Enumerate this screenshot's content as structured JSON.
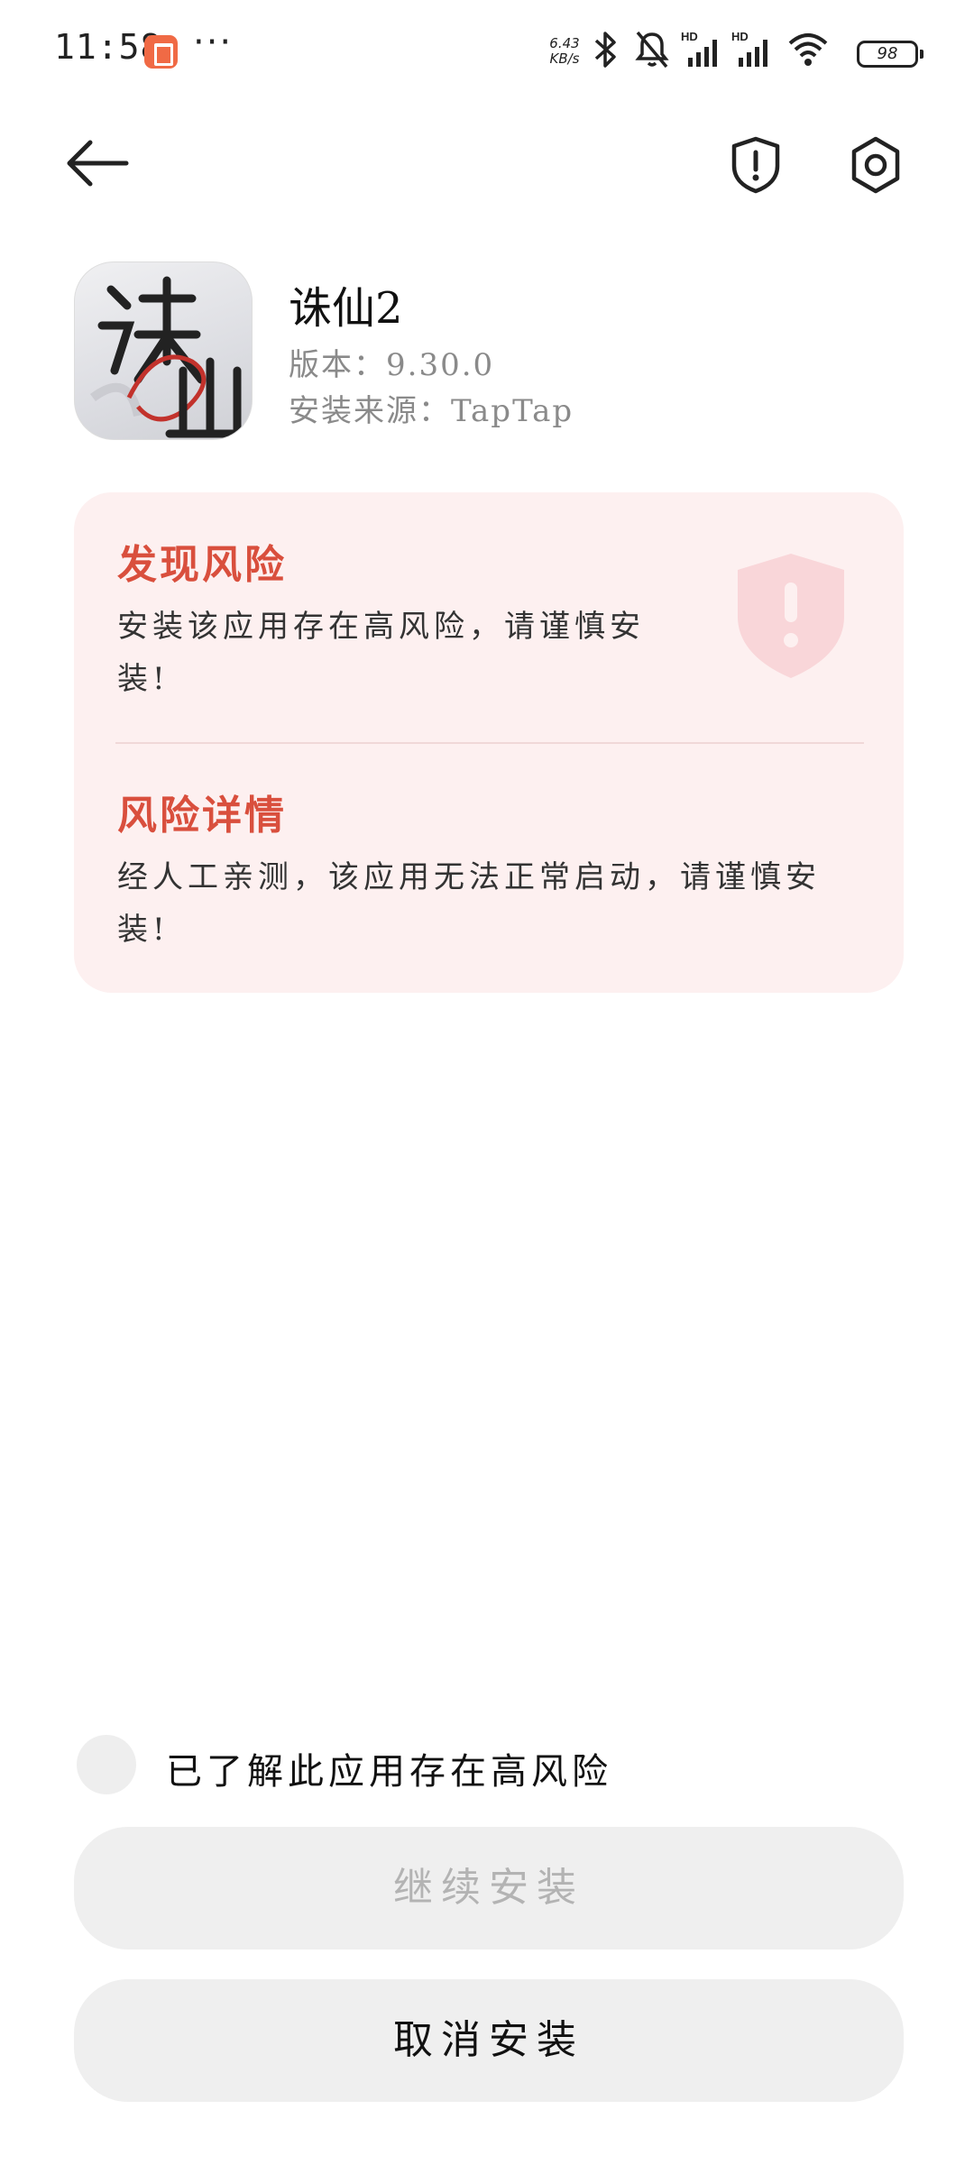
{
  "status_bar": {
    "time": "11:58",
    "dots": "···",
    "speed_value": "6.43",
    "speed_unit": "KB/s",
    "hd_label": "HD",
    "battery": "98",
    "icons": [
      "bluetooth-icon",
      "mute-bell-icon",
      "signal-hd-icon",
      "signal-hd-icon",
      "wifi-icon",
      "battery-icon"
    ]
  },
  "top_bar": {
    "icons": [
      "back-arrow-icon",
      "shield-alert-icon",
      "settings-gear-icon"
    ]
  },
  "app": {
    "name": "诛仙2",
    "version": "版本：9.30.0",
    "source": "安装来源：TapTap"
  },
  "risk_card": {
    "title": "发现风险",
    "text": "安装该应用存在高风险，请谨慎安装!",
    "details_title": "风险详情",
    "details_text": "经人工亲测，该应用无法正常启动，请谨慎安装!",
    "accent_color": "#d94f3d",
    "background_color": "#fdf0f0"
  },
  "bottom": {
    "acknowledge_label": "已了解此应用存在高风险",
    "continue_label": "继续安装",
    "cancel_label": "取消安装"
  }
}
